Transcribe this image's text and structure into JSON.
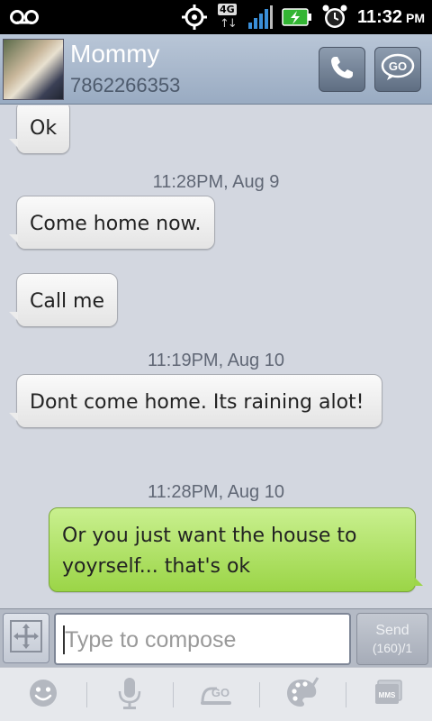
{
  "status_bar": {
    "network_label": "4G",
    "time": "11:32",
    "ampm": "PM",
    "icons": [
      "voicemail-icon",
      "gps-icon",
      "signal-icon",
      "battery-charging-icon",
      "alarm-icon"
    ]
  },
  "contact": {
    "name": "Mommy",
    "number": "7862266353",
    "call_icon": "phone-icon",
    "go_label": "GO"
  },
  "messages": [
    {
      "type": "message",
      "direction": "in",
      "text": "Ok"
    },
    {
      "type": "timestamp",
      "text": "11:28PM, Aug 9"
    },
    {
      "type": "message",
      "direction": "in",
      "text": "Come home now."
    },
    {
      "type": "message",
      "direction": "in",
      "text": "Call me"
    },
    {
      "type": "timestamp",
      "text": "11:19PM, Aug 10"
    },
    {
      "type": "message",
      "direction": "in",
      "text": "Dont come home. Its raining alot!"
    },
    {
      "type": "timestamp",
      "text": "11:28PM, Aug 10"
    },
    {
      "type": "message",
      "direction": "out",
      "text": "Or you just want the house to yoyrself... that's ok"
    }
  ],
  "compose": {
    "placeholder": "Type to compose",
    "value": "",
    "send_label": "Send",
    "char_count": "(160)/1"
  },
  "toolbar": {
    "icons": [
      "smiley-icon",
      "microphone-icon",
      "go-icon",
      "palette-icon",
      "mms-icon"
    ],
    "mms_label": "MMS"
  },
  "colors": {
    "incoming_bubble": "#e8e8e8",
    "outgoing_bubble": "#b3e26a",
    "header": "#a9b8cc",
    "background": "#d3d7e0"
  }
}
